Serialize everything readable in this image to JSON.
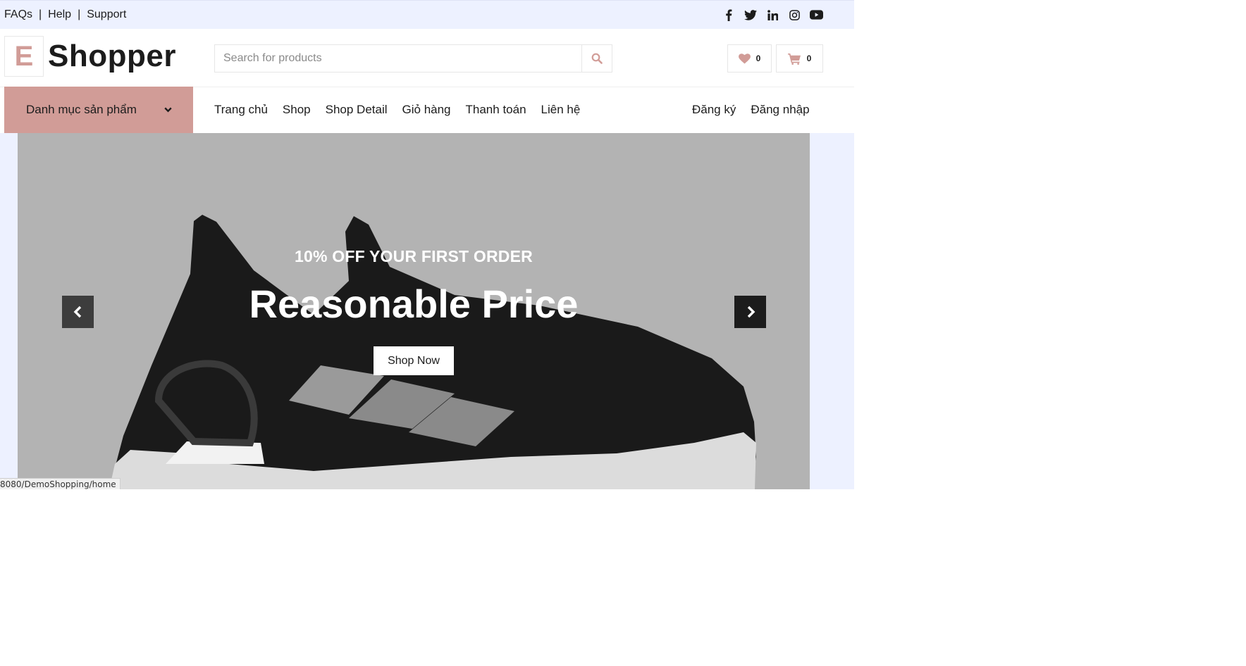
{
  "topbar": {
    "links": [
      "FAQs",
      "Help",
      "Support"
    ],
    "separator": "|",
    "social": [
      "facebook-icon",
      "twitter-icon",
      "linkedin-icon",
      "instagram-icon",
      "youtube-icon"
    ]
  },
  "header": {
    "logo_letter": "E",
    "logo_text": "Shopper",
    "search_placeholder": "Search for products",
    "wishlist_count": "0",
    "cart_count": "0"
  },
  "nav": {
    "category_label": "Danh mục sản phẩm",
    "links": [
      "Trang chủ",
      "Shop",
      "Shop Detail",
      "Giỏ hàng",
      "Thanh toán",
      "Liên hệ"
    ],
    "auth": [
      "Đăng ký",
      "Đăng nhập"
    ]
  },
  "hero": {
    "offer": "10% OFF YOUR FIRST ORDER",
    "headline": "Reasonable Price",
    "button": "Shop Now"
  },
  "status_url": "8080/DemoShopping/home",
  "colors": {
    "accent": "#d19c97",
    "topbar": "#edf1ff",
    "hero_bg": "#b3b3b3",
    "dark": "#1c1c1c"
  }
}
